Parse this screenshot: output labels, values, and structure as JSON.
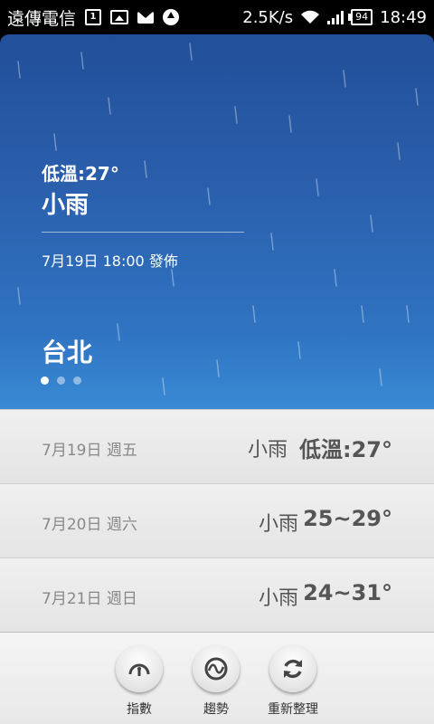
{
  "status_bar": {
    "carrier": "遠傳電信",
    "calendar_day": "1",
    "network_speed": "2.5K/s",
    "battery": "94",
    "time": "18:49",
    "icons": [
      "calendar-icon",
      "image-icon",
      "mail-icon",
      "upload-icon",
      "wifi-icon",
      "signal-icon",
      "battery-icon"
    ]
  },
  "current": {
    "low_temp": "低溫:27°",
    "condition": "小雨",
    "published": "7月19日 18:00 發佈",
    "city": "台北",
    "page_count": 3,
    "page_active": 0
  },
  "forecast": [
    {
      "date": "7月19日 週五",
      "condition": "小雨",
      "temp": "低溫:27°"
    },
    {
      "date": "7月20日 週六",
      "condition": "小雨",
      "temp": "25~29°"
    },
    {
      "date": "7月21日 週日",
      "condition": "小雨",
      "temp": "24~31°"
    }
  ],
  "toolbar": {
    "index_label": "指數",
    "trend_label": "趨勢",
    "refresh_label": "重新整理"
  },
  "colors": {
    "sky_top": "#224f99",
    "sky_bottom": "#3a8ad4"
  }
}
